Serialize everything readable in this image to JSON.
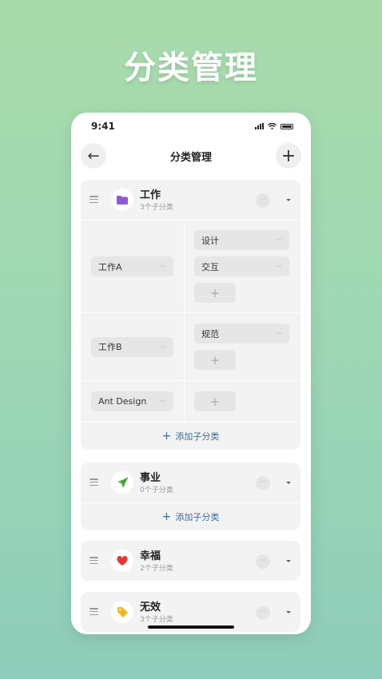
{
  "headline": "分类管理",
  "status_bar": {
    "time": "9:41"
  },
  "nav": {
    "title": "分类管理",
    "back_icon": "←",
    "add_icon": "+"
  },
  "more_icon": "···",
  "plus_icon": "+",
  "add_sub_label": "添加子分类",
  "categories": [
    {
      "name": "工作",
      "sub_count": "3个子分类",
      "icon": "folder-icon",
      "icon_color": "#8a5cd6",
      "groups": [
        {
          "name": "工作A",
          "children": [
            "设计",
            "交互"
          ]
        },
        {
          "name": "工作B",
          "children": [
            "规范"
          ]
        },
        {
          "name": "Ant Design",
          "children": []
        }
      ]
    },
    {
      "name": "事业",
      "sub_count": "0个子分类",
      "icon": "paper-plane-icon",
      "icon_color": "#46b336"
    },
    {
      "name": "幸福",
      "sub_count": "2个子分类",
      "icon": "heart-icon",
      "icon_color": "#e53935"
    },
    {
      "name": "无效",
      "sub_count": "3个子分类",
      "icon": "tag-icon",
      "icon_color": "#f2b81c"
    }
  ]
}
